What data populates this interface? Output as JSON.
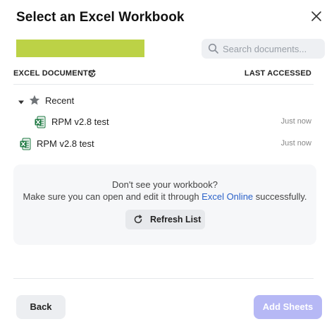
{
  "dialog": {
    "title": "Select an Excel Workbook"
  },
  "account_block": {
    "color": "#bcd246"
  },
  "search": {
    "placeholder": "Search documents..."
  },
  "list_header": {
    "left_label": "EXCEL DOCUMENTS",
    "right_label": "LAST ACCESSED"
  },
  "recent_group": {
    "label": "Recent",
    "items": [
      {
        "name": "RPM v2.8 test",
        "last_accessed": "Just now"
      }
    ]
  },
  "documents": [
    {
      "name": "RPM v2.8 test",
      "last_accessed": "Just now"
    }
  ],
  "help": {
    "line1": "Don't see your workbook?",
    "line2_before": "Make sure you can open and edit it through ",
    "line2_link": "Excel Online",
    "line2_after": " successfully.",
    "refresh_label": "Refresh List"
  },
  "footer": {
    "back_label": "Back",
    "add_label": "Add Sheets"
  },
  "colors": {
    "accent_disabled": "#b6b8f5",
    "link": "#2b62c9",
    "excel_green": "#1f7a43"
  },
  "icons": [
    "close-icon",
    "search-icon",
    "refresh-icon",
    "caret-down-icon",
    "star-icon",
    "excel-file-icon"
  ]
}
